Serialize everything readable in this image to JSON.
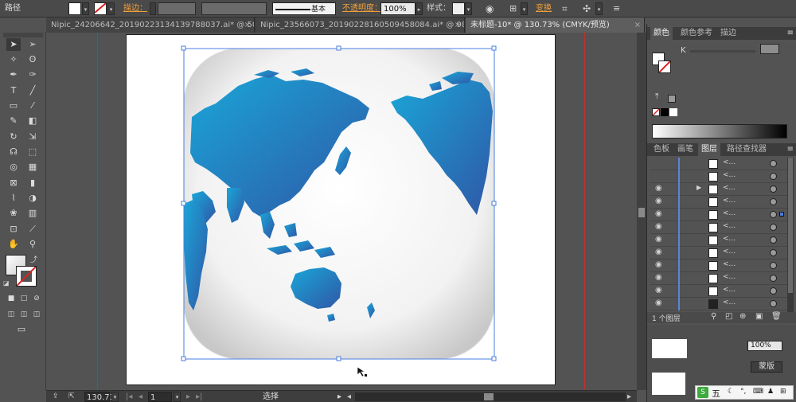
{
  "control_bar": {
    "object_type": "路径",
    "stroke_label": "描边：",
    "stroke_style": "基本",
    "opacity_label": "不透明度：",
    "opacity_value": "100%",
    "style_label": "样式：",
    "transform_label": "变换"
  },
  "tabs": [
    {
      "label": "Nipic_24206642_20190223134139788037.ai* @ 50...",
      "close": "×"
    },
    {
      "label": "Nipic_23566073_20190228160509458084.ai* @ 98...",
      "close": "×"
    },
    {
      "label": "未标题-10* @ 130.73% (CMYK/预览)",
      "close": "×"
    }
  ],
  "status_bar": {
    "zoom": "130.73",
    "artboard": "1",
    "tool": "选择"
  },
  "color_panel": {
    "tabs": [
      "颜色",
      "颜色参考",
      "描边"
    ],
    "channel": "K",
    "value": ""
  },
  "layers_panel": {
    "tabs": [
      "色板",
      "画笔",
      "图层",
      "路径查找器"
    ],
    "row_label": "<...",
    "rows": 12,
    "footer": "1 个图层"
  },
  "overlay": {
    "opacity_value": "100%",
    "mask_button": "蒙版",
    "ime": "五"
  },
  "colors": {
    "map_blue_light": "#1ea3d6",
    "map_blue_dark": "#2c5aa8",
    "guide_red": "#c0322f",
    "selection_blue": "#4a7ee0"
  },
  "icons": [
    "selection-tool-icon",
    "direct-selection-icon",
    "magic-wand-icon",
    "lasso-icon",
    "pen-icon",
    "type-icon",
    "line-icon",
    "rectangle-icon",
    "paintbrush-icon",
    "pencil-icon",
    "eraser-icon",
    "rotate-icon",
    "scale-icon",
    "warp-icon",
    "free-transform-icon",
    "shape-builder-icon",
    "perspective-icon",
    "mesh-icon",
    "gradient-icon",
    "eyedropper-icon",
    "blend-icon",
    "symbol-sprayer-icon",
    "graph-icon",
    "artboard-icon",
    "slice-icon",
    "hand-icon",
    "zoom-icon",
    "eye-icon",
    "close-icon"
  ]
}
